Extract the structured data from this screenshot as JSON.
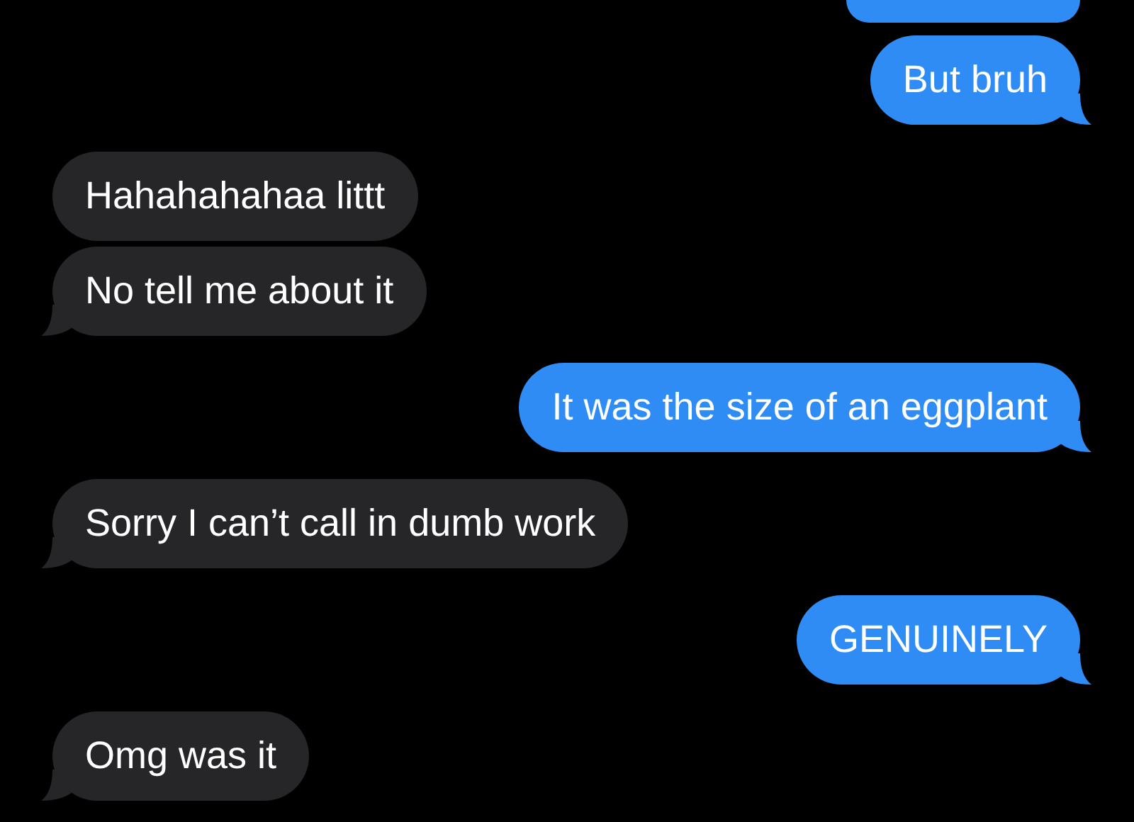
{
  "messages": [
    {
      "kind": "sent_cut"
    },
    {
      "kind": "sent",
      "text": "But bruh",
      "tail": true
    },
    {
      "kind": "received",
      "text": "Hahahahahaa littt",
      "tail": false
    },
    {
      "kind": "received",
      "text": "No tell me about it",
      "tail": true
    },
    {
      "kind": "sent",
      "text": "It was the size of an eggplant",
      "tail": true
    },
    {
      "kind": "received",
      "text": "Sorry I can’t call in dumb work",
      "tail": true
    },
    {
      "kind": "sent",
      "text": "GENUINELY",
      "tail": true
    },
    {
      "kind": "received",
      "text": "Omg was it",
      "tail": true
    }
  ]
}
